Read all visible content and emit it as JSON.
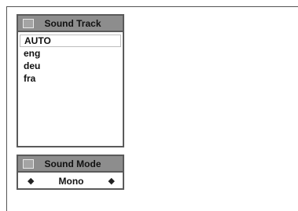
{
  "sound_track": {
    "title": "Sound Track",
    "header_icon": "square-icon",
    "items": [
      {
        "label": "AUTO",
        "selected": true
      },
      {
        "label": "eng",
        "selected": false
      },
      {
        "label": "deu",
        "selected": false
      },
      {
        "label": "fra",
        "selected": false
      }
    ]
  },
  "sound_mode": {
    "title": "Sound Mode",
    "header_icon": "square-icon",
    "value": "Mono",
    "left_arrow": "◆",
    "right_arrow": "◆"
  }
}
